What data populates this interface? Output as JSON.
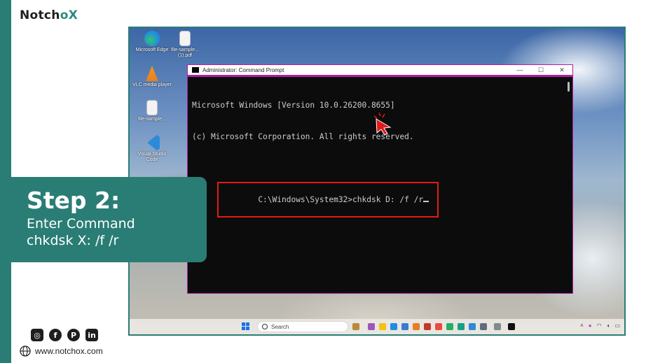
{
  "brand": {
    "name_left": "Notch",
    "name_o": "o",
    "name_x": "X"
  },
  "step": {
    "title": "Step 2:",
    "line1": "Enter Command",
    "line2": "chkdsk X: /f /r"
  },
  "footer": {
    "website": "www.notchox.com",
    "socials": [
      "instagram-icon",
      "facebook-icon",
      "pinterest-icon",
      "linkedin-icon"
    ]
  },
  "desktop": {
    "icons": [
      {
        "label": "Microsoft Edge",
        "color": "#1f8ee0"
      },
      {
        "label": "file-sample...(1).pdf",
        "color": "#e5e5e5"
      },
      {
        "label": "VLC media player",
        "color": "#f08a00"
      },
      {
        "label": "file-sample...",
        "color": "#e5e5e5"
      },
      {
        "label": "Visual Studio Code",
        "color": "#2c8ad6"
      }
    ]
  },
  "cmd": {
    "title": "Administrator: Command Prompt",
    "line1": "Microsoft Windows [Version 10.0.26200.8655]",
    "line2": "(c) Microsoft Corporation. All rights reserved.",
    "prompt": "C:\\Windows\\System32>chkdsk D: /f /r",
    "border_color": "#b21ea5",
    "highlight_color": "#e21a1a"
  },
  "taskbar": {
    "search_placeholder": "Search"
  },
  "colors": {
    "accent": "#2a7d75"
  }
}
